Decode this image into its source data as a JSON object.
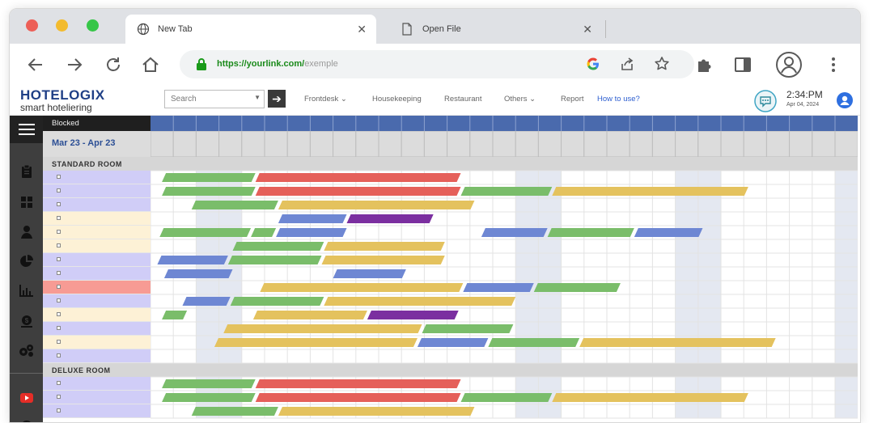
{
  "browser": {
    "tabs": [
      {
        "label": "New Tab",
        "active": true
      },
      {
        "label": "Open File",
        "active": false
      }
    ],
    "url_host": "https://yourlink.com/",
    "url_path": "exemple"
  },
  "app": {
    "logo_line1": "HOTELOGIX",
    "logo_line2": "smart hoteliering",
    "search_placeholder": "Search",
    "menu": [
      {
        "label": "Frontdesk",
        "dropdown": true
      },
      {
        "label": "Housekeeping",
        "dropdown": false
      },
      {
        "label": "Restaurant",
        "dropdown": false
      },
      {
        "label": "Others",
        "dropdown": true
      },
      {
        "label": "Report",
        "dropdown": false
      },
      {
        "label": "How to use?",
        "dropdown": false,
        "link": true
      }
    ],
    "time": "2:34:PM",
    "date": "Apr 04, 2024",
    "colors": {
      "accent": "#2e5fd0",
      "header_blue": "#4a6aad",
      "green": "#7abd6a",
      "red": "#e5605a",
      "yellow": "#e4c25e",
      "blue": "#6e87d3",
      "purple": "#7b2fa0"
    }
  },
  "calendar": {
    "blocked_label": "Blocked",
    "date_range": "Mar 23 - Apr 23",
    "sections": [
      {
        "name": "STANDARD ROOM",
        "rows": [
          {
            "bg": "lavender",
            "bars": [
              {
                "s": 0.5,
                "e": 4.6,
                "c": "green"
              },
              {
                "s": 4.6,
                "e": 13.6,
                "c": "red"
              }
            ]
          },
          {
            "bg": "lavender",
            "bars": [
              {
                "s": 0.5,
                "e": 4.6,
                "c": "green"
              },
              {
                "s": 4.6,
                "e": 13.6,
                "c": "red"
              },
              {
                "s": 13.6,
                "e": 17.6,
                "c": "green"
              },
              {
                "s": 17.6,
                "e": 26.2,
                "c": "yellow"
              }
            ]
          },
          {
            "bg": "lavender",
            "bars": [
              {
                "s": 1.8,
                "e": 5.6,
                "c": "green"
              },
              {
                "s": 5.6,
                "e": 14.2,
                "c": "yellow"
              }
            ]
          },
          {
            "bg": "cream",
            "bars": [
              {
                "s": 5.6,
                "e": 8.6,
                "c": "blue"
              },
              {
                "s": 8.6,
                "e": 12.4,
                "c": "purple"
              }
            ]
          },
          {
            "bg": "cream",
            "bars": [
              {
                "s": 0.4,
                "e": 4.4,
                "c": "green"
              },
              {
                "s": 4.4,
                "e": 5.5,
                "c": "green"
              },
              {
                "s": 5.5,
                "e": 8.6,
                "c": "blue"
              },
              {
                "s": 14.5,
                "e": 17.4,
                "c": "blue"
              },
              {
                "s": 17.4,
                "e": 21.2,
                "c": "green"
              },
              {
                "s": 21.2,
                "e": 24.2,
                "c": "blue"
              }
            ]
          },
          {
            "bg": "cream",
            "bars": [
              {
                "s": 3.6,
                "e": 7.6,
                "c": "green"
              },
              {
                "s": 7.6,
                "e": 12.9,
                "c": "yellow"
              }
            ]
          },
          {
            "bg": "lavender",
            "bars": [
              {
                "s": 0.3,
                "e": 3.4,
                "c": "blue"
              },
              {
                "s": 3.4,
                "e": 7.5,
                "c": "green"
              },
              {
                "s": 7.5,
                "e": 12.9,
                "c": "yellow"
              }
            ]
          },
          {
            "bg": "lavender",
            "bars": [
              {
                "s": 0.6,
                "e": 3.6,
                "c": "blue"
              },
              {
                "s": 8.0,
                "e": 11.2,
                "c": "blue"
              }
            ]
          },
          {
            "bg": "red",
            "bars": [
              {
                "s": 4.8,
                "e": 13.7,
                "c": "yellow"
              },
              {
                "s": 13.7,
                "e": 16.8,
                "c": "blue"
              },
              {
                "s": 16.8,
                "e": 20.6,
                "c": "green"
              }
            ]
          },
          {
            "bg": "lavender",
            "bars": [
              {
                "s": 1.4,
                "e": 3.5,
                "c": "blue"
              },
              {
                "s": 3.5,
                "e": 7.6,
                "c": "green"
              },
              {
                "s": 7.6,
                "e": 16.0,
                "c": "yellow"
              }
            ]
          },
          {
            "bg": "cream",
            "bars": [
              {
                "s": 0.5,
                "e": 1.6,
                "c": "green"
              },
              {
                "s": 4.5,
                "e": 9.5,
                "c": "yellow"
              },
              {
                "s": 9.5,
                "e": 13.5,
                "c": "purple"
              }
            ]
          },
          {
            "bg": "lavender",
            "bars": [
              {
                "s": 3.2,
                "e": 11.9,
                "c": "yellow"
              },
              {
                "s": 11.9,
                "e": 15.9,
                "c": "green"
              }
            ]
          },
          {
            "bg": "cream",
            "bars": [
              {
                "s": 2.8,
                "e": 11.7,
                "c": "yellow"
              },
              {
                "s": 11.7,
                "e": 14.8,
                "c": "blue"
              },
              {
                "s": 14.8,
                "e": 18.8,
                "c": "green"
              },
              {
                "s": 18.8,
                "e": 27.4,
                "c": "yellow"
              }
            ]
          },
          {
            "bg": "lavender",
            "bars": []
          }
        ]
      },
      {
        "name": "DELUXE ROOM",
        "rows": [
          {
            "bg": "lavender",
            "bars": [
              {
                "s": 0.5,
                "e": 4.6,
                "c": "green"
              },
              {
                "s": 4.6,
                "e": 13.6,
                "c": "red"
              }
            ]
          },
          {
            "bg": "lavender",
            "bars": [
              {
                "s": 0.5,
                "e": 4.6,
                "c": "green"
              },
              {
                "s": 4.6,
                "e": 13.6,
                "c": "red"
              },
              {
                "s": 13.6,
                "e": 17.6,
                "c": "green"
              },
              {
                "s": 17.6,
                "e": 26.2,
                "c": "yellow"
              }
            ]
          },
          {
            "bg": "lavender",
            "bars": [
              {
                "s": 1.8,
                "e": 5.6,
                "c": "green"
              },
              {
                "s": 5.6,
                "e": 14.2,
                "c": "yellow"
              }
            ]
          }
        ]
      }
    ]
  }
}
